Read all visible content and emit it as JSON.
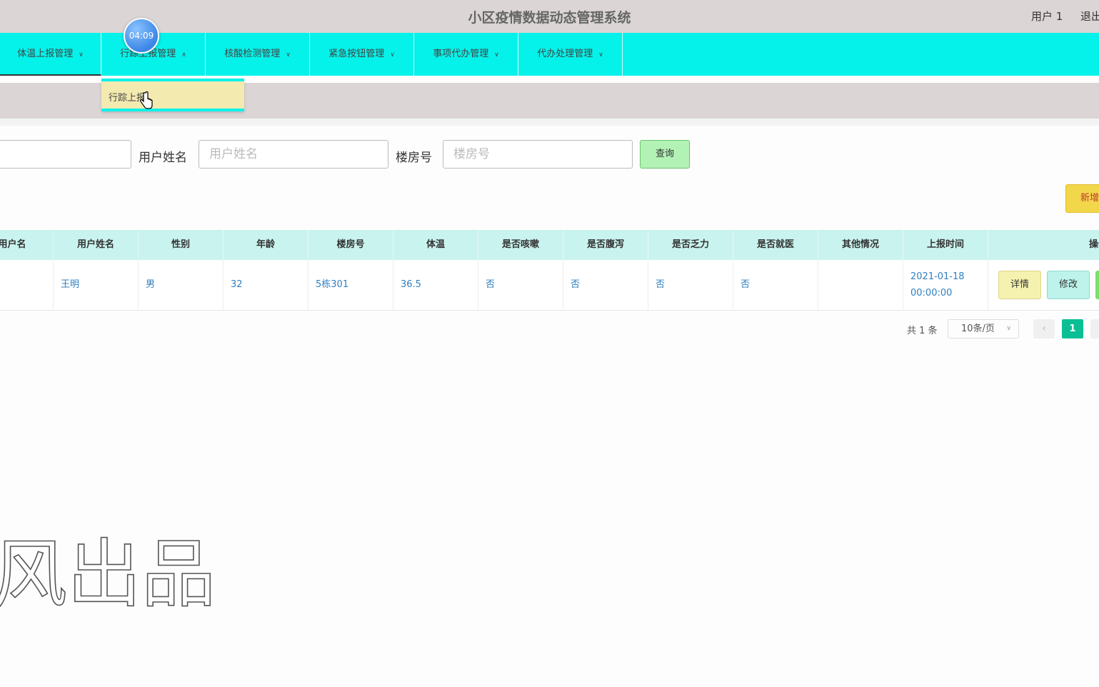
{
  "header": {
    "title": "小区疫情数据动态管理系统",
    "user": "用户 1",
    "logout": "退出"
  },
  "timer": "04:09",
  "nav": {
    "items": [
      {
        "label": "体温上报管理",
        "active": true
      },
      {
        "label": "行踪上报管理",
        "active": false,
        "open": true
      },
      {
        "label": "核酸检测管理",
        "active": false
      },
      {
        "label": "紧急按钮管理",
        "active": false
      },
      {
        "label": "事项代办管理",
        "active": false
      },
      {
        "label": "代办处理管理",
        "active": false
      }
    ],
    "dropdown_item": "行踪上报"
  },
  "search": {
    "username_label": "用户姓名",
    "username_placeholder": "用户姓名",
    "building_label": "楼房号",
    "building_placeholder": "楼房号",
    "query_button": "查询",
    "add_button": "新增"
  },
  "table": {
    "headers": [
      "用户名",
      "用户姓名",
      "性别",
      "年龄",
      "楼房号",
      "体温",
      "是否咳嗽",
      "是否腹泻",
      "是否乏力",
      "是否就医",
      "其他情况",
      "上报时间",
      "操作"
    ],
    "rows": [
      {
        "username": "",
        "name": "王明",
        "gender": "男",
        "age": "32",
        "building": "5栋301",
        "temperature": "36.5",
        "cough": "否",
        "diarrhea": "否",
        "fatigue": "否",
        "hospital": "否",
        "other": "",
        "report_time": "2021-01-18 00:00:00"
      }
    ],
    "actions": {
      "detail": "详情",
      "edit": "修改"
    }
  },
  "pagination": {
    "total": "共 1 条",
    "page_size": "10条/页",
    "current_page": "1"
  },
  "watermark": "风出品",
  "colors": {
    "nav_bg": "#05f2ea",
    "header_bg": "#dcd5d5",
    "table_header_bg": "#c9f3ee",
    "link_text": "#2f7fc0",
    "page_active": "#0bbf94"
  }
}
